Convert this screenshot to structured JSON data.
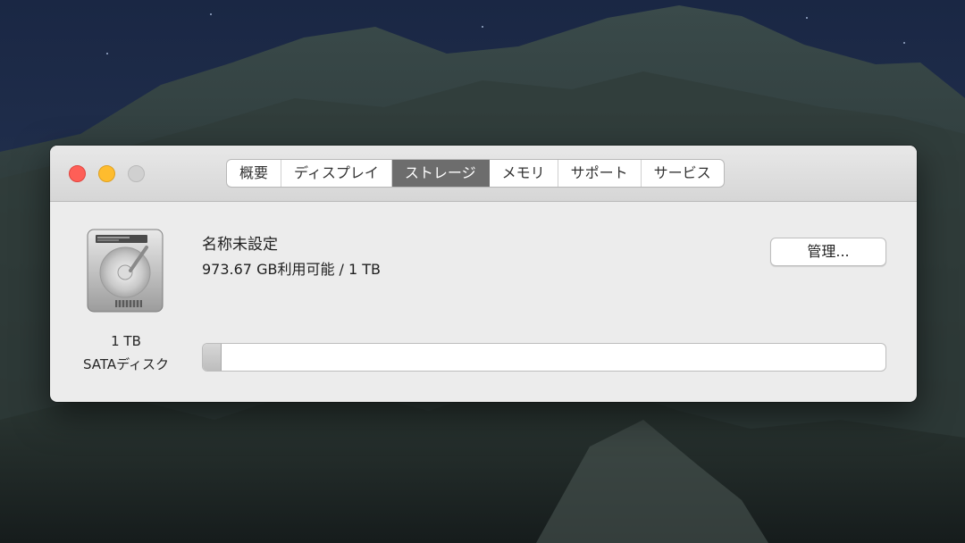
{
  "window": {
    "tabs": [
      {
        "label": "概要",
        "active": false
      },
      {
        "label": "ディスプレイ",
        "active": false
      },
      {
        "label": "ストレージ",
        "active": true
      },
      {
        "label": "メモリ",
        "active": false
      },
      {
        "label": "サポート",
        "active": false
      },
      {
        "label": "サービス",
        "active": false
      }
    ]
  },
  "drive": {
    "icon": "hard-drive-icon",
    "size_label": "1 TB",
    "type_label": "SATAディスク"
  },
  "volume": {
    "name": "名称未設定",
    "availability": "973.67 GB利用可能 / 1 TB",
    "used_fraction": 0.026
  },
  "buttons": {
    "manage_label": "管理..."
  },
  "colors": {
    "close": "#fe5f57",
    "minimize": "#febc2e",
    "zoom_disabled": "#d0d0d0",
    "active_tab": "#6d6d6d"
  }
}
